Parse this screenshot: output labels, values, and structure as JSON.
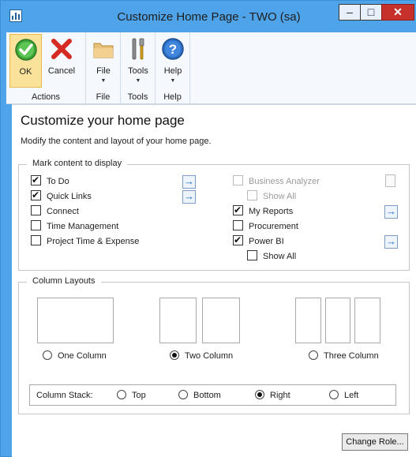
{
  "window": {
    "title": "Customize Home Page  -  TWO (sa)",
    "controls": {
      "minimize": "–",
      "maximize": "□",
      "close": "✕"
    }
  },
  "ribbon": {
    "groups": [
      {
        "label": "Actions",
        "buttons": [
          {
            "label": "OK",
            "icon": "ok-checkmark-icon"
          },
          {
            "label": "Cancel",
            "icon": "cancel-x-icon"
          }
        ]
      },
      {
        "label": "File",
        "buttons": [
          {
            "label": "File",
            "icon": "folder-icon",
            "has_dropdown": true
          }
        ]
      },
      {
        "label": "Tools",
        "buttons": [
          {
            "label": "Tools",
            "icon": "tools-icon",
            "has_dropdown": true
          }
        ]
      },
      {
        "label": "Help",
        "buttons": [
          {
            "label": "Help",
            "icon": "help-icon",
            "has_dropdown": true
          }
        ]
      }
    ]
  },
  "page": {
    "heading": "Customize your home page",
    "subtext": "Modify the content and layout of your home page.",
    "mark_content": {
      "legend": "Mark content to display",
      "left_items": [
        {
          "label": "To Do",
          "checked": true
        },
        {
          "label": "Quick Links",
          "checked": true
        },
        {
          "label": "Connect",
          "checked": false
        },
        {
          "label": "Time Management",
          "checked": false
        },
        {
          "label": "Project Time & Expense",
          "checked": false
        }
      ],
      "right_items": [
        {
          "label": "Business Analyzer",
          "checked": false,
          "disabled": true
        },
        {
          "label": "Show All",
          "checked": false,
          "disabled": true
        },
        {
          "label": "My Reports",
          "checked": true
        },
        {
          "label": "Procurement",
          "checked": false
        },
        {
          "label": "Power BI",
          "checked": true
        },
        {
          "label": "Show All",
          "checked": false
        }
      ],
      "arrow_icon": "→"
    },
    "column_layouts": {
      "legend": "Column Layouts",
      "options": [
        {
          "label": "One Column",
          "selected": false
        },
        {
          "label": "Two Column",
          "selected": true
        },
        {
          "label": "Three Column",
          "selected": false
        }
      ],
      "stack": {
        "label": "Column Stack:",
        "options": [
          {
            "label": "Top",
            "selected": false
          },
          {
            "label": "Bottom",
            "selected": false
          },
          {
            "label": "Right",
            "selected": true
          },
          {
            "label": "Left",
            "selected": false
          }
        ]
      }
    },
    "change_role_label": "Change Role..."
  },
  "colors": {
    "title_bar": "#4fa3e8",
    "ribbon_bg": "#f5f9fd",
    "ok_highlight": "#fbe29a",
    "close_button": "#c7312b",
    "arrow_blue": "#1a6ec9"
  }
}
